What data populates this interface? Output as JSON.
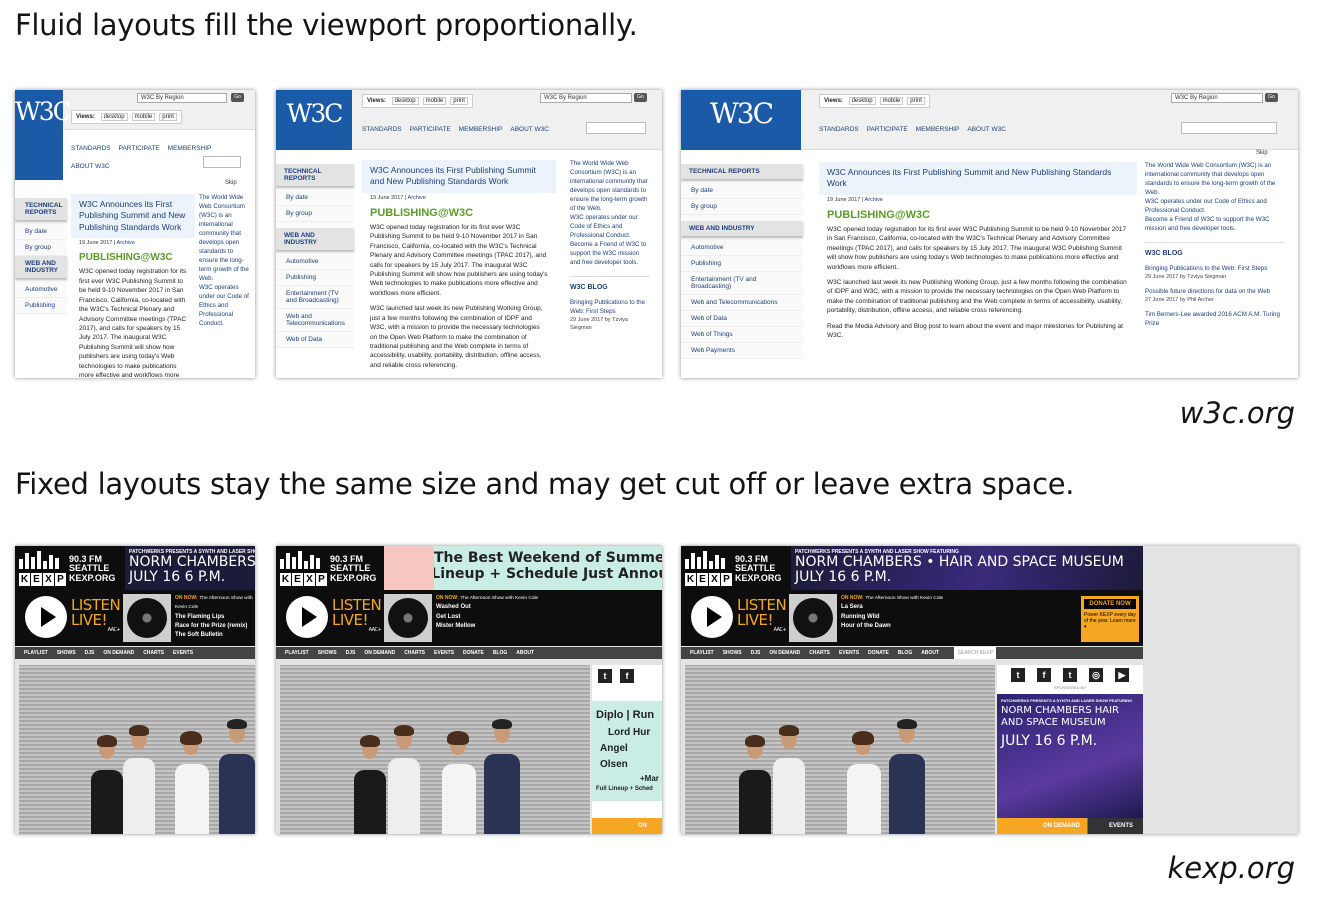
{
  "fluid": {
    "heading": "Fluid layouts fill the viewport proportionally.",
    "source": "w3c.org"
  },
  "fixed": {
    "heading": "Fixed layouts stay the same size and may get cut off or leave extra space.",
    "source": "kexp.org"
  },
  "w3c": {
    "logo": "W3C",
    "views_label": "Views:",
    "views": [
      "desktop",
      "mobile",
      "print"
    ],
    "region": "W3C By Region",
    "go": "Go",
    "nav": [
      "STANDARDS",
      "PARTICIPATE",
      "MEMBERSHIP",
      "ABOUT W3C"
    ],
    "skip": "Skip",
    "side": {
      "technical_reports": "TECHNICAL REPORTS",
      "by_date": "By date",
      "by_group": "By group",
      "web_industry": "WEB AND INDUSTRY",
      "industry_items": [
        "Automotive",
        "Publishing",
        "Entertainment (TV and Broadcasting)",
        "Web and Telecommunications",
        "Web of Data",
        "Web of Things",
        "Web Payments"
      ]
    },
    "article": {
      "title": "W3C Announces its First Publishing Summit and New Publishing Standards Work",
      "date": "19 June 2017",
      "archive": "Archive",
      "logo": "PUBLISHING@W3C",
      "p1": "W3C opened today registration for its first ever W3C Publishing Summit to be held 9-10 November 2017 in San Francisco, California, co-located with the W3C's Technical Plenary and Advisory Committee meetings (TPAC 2017), and calls for speakers by 15 July 2017. The inaugural W3C Publishing Summit will show how publishers are using today's Web technologies to make publications more effective and workflows more efficient.",
      "p2": "W3C launched last week its new Publishing Working Group, just a few months following the combination of IDPF and W3C, with a mission to provide the necessary technologies on the Open Web Platform to make the combination of traditional publishing and the Web complete in terms of accessibility, usability, portability, distribution, offline access, and reliable cross referencing.",
      "p3": "Read the Media Advisory and Blog post to learn about the event and major milestones for Publishing at W3C."
    },
    "about": "The World Wide Web Consortium (W3C) is an international community that develops open standards to ensure the long-term growth of the Web.",
    "conduct": "W3C operates under our Code of Ethics and Professional Conduct.",
    "friend": "Become a Friend of W3C to support the W3C mission and free developer tools.",
    "blog_heading": "W3C BLOG",
    "blog": [
      {
        "title": "Bringing Publications to the Web: First Steps",
        "meta": "29 June 2017 by Tzviya Siegman"
      },
      {
        "title": "Possible future directions for data on the Web",
        "meta": "27 June 2017 by Phil Archer"
      },
      {
        "title": "Tim Berners-Lee awarded 2016 ACM A.M. Turing Prize",
        "meta": ""
      }
    ]
  },
  "kexp": {
    "letters": [
      "K",
      "E",
      "X",
      "P"
    ],
    "station_lines": [
      "90.3 FM",
      "SEATTLE",
      "KEXP.ORG"
    ],
    "banner_pre": "PATCHWERKS PRESENTS A SYNTH AND LASER SHOW FEATURING",
    "banner_title": "NORM CHAMBERS • HAIR AND SPACE MUSEUM",
    "banner_date": "JULY 16   6 P.M.",
    "banner_alt_1": "The Best Weekend of Summer",
    "banner_alt_2": "Full Lineup + Schedule Just Announced",
    "listen": "LISTEN",
    "live": "LIVE!",
    "aac": "AAC+",
    "on_now": "ON NOW:",
    "show": "The Afternoon Show with Kevin Cole",
    "tracks_a": [
      "The Flaming Lips",
      "Race for the Prize (remix)",
      "The Soft Bulletin"
    ],
    "tracks_b": [
      "Washed Out",
      "Get Lost",
      "Mister Mellow"
    ],
    "tracks_c": [
      "La Sera",
      "Running Wild",
      "Hour of the Dawn"
    ],
    "nav": [
      "PLAYLIST",
      "SHOWS",
      "DJS",
      "ON DEMAND",
      "CHARTS",
      "EVENTS",
      "DONATE",
      "BLOG",
      "ABOUT"
    ],
    "search": "SEARCH KEXP",
    "festival": [
      "Diplo | Run",
      "Lord Hur",
      "Angel Olsen",
      "+Mar"
    ],
    "festival_foot": "Full Lineup + Sched",
    "sponsored": "SPONSORED BY",
    "ad_title": "NORM CHAMBERS HAIR AND SPACE MUSEUM",
    "ad_date": "JULY 16   6 P.M.",
    "donate": "DONATE NOW",
    "donate_text": "Power KEXP every day of the year. Learn more ▾",
    "on_demand": "ON DEMAND",
    "events": "EVENTS"
  }
}
